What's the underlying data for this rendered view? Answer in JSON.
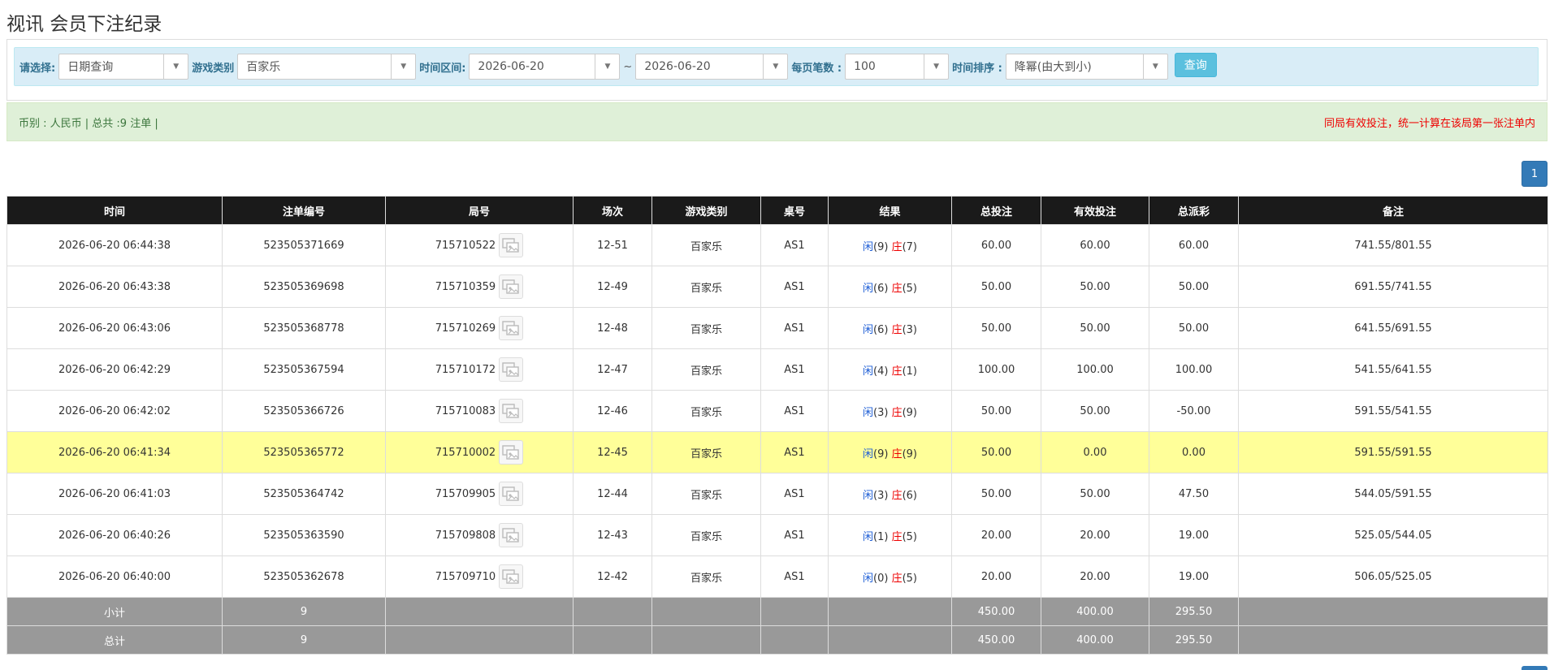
{
  "page": {
    "title": "视讯 会员下注纪录"
  },
  "filters": {
    "select_label": "请选择:",
    "select_value": "日期查询",
    "game_label": "游戏类别",
    "game_value": "百家乐",
    "time_label": "时间区间:",
    "date_from": "2026-06-20",
    "tilde": "~",
    "date_to": "2026-06-20",
    "per_page_label": "每页笔数 :",
    "per_page_value": "100",
    "sort_label": "时间排序 :",
    "sort_value": "降幂(由大到小)",
    "query_button": "查询"
  },
  "summary": {
    "left": "币别 : 人民币 | 总共 :9 注单 |",
    "right": "同局有效投注，统一计算在该局第一张注单内"
  },
  "pagination": {
    "current": "1"
  },
  "table": {
    "headers": [
      "时间",
      "注单编号",
      "局号",
      "场次",
      "游戏类别",
      "桌号",
      "结果",
      "总投注",
      "有效投注",
      "总派彩",
      "备注"
    ],
    "rows": [
      {
        "time": "2026-06-20 06:44:38",
        "bet_id": "523505371669",
        "round": "715710522",
        "session": "12-51",
        "game": "百家乐",
        "table": "AS1",
        "player_label": "闲",
        "player_pts": "(9)",
        "banker_label": "庄",
        "banker_pts": "(7)",
        "total_bet": "60.00",
        "valid_bet": "60.00",
        "payout": "60.00",
        "payout_negative": false,
        "note": "741.55/801.55",
        "highlight": false
      },
      {
        "time": "2026-06-20 06:43:38",
        "bet_id": "523505369698",
        "round": "715710359",
        "session": "12-49",
        "game": "百家乐",
        "table": "AS1",
        "player_label": "闲",
        "player_pts": "(6)",
        "banker_label": "庄",
        "banker_pts": "(5)",
        "total_bet": "50.00",
        "valid_bet": "50.00",
        "payout": "50.00",
        "payout_negative": false,
        "note": "691.55/741.55",
        "highlight": false
      },
      {
        "time": "2026-06-20 06:43:06",
        "bet_id": "523505368778",
        "round": "715710269",
        "session": "12-48",
        "game": "百家乐",
        "table": "AS1",
        "player_label": "闲",
        "player_pts": "(6)",
        "banker_label": "庄",
        "banker_pts": "(3)",
        "total_bet": "50.00",
        "valid_bet": "50.00",
        "payout": "50.00",
        "payout_negative": false,
        "note": "641.55/691.55",
        "highlight": false
      },
      {
        "time": "2026-06-20 06:42:29",
        "bet_id": "523505367594",
        "round": "715710172",
        "session": "12-47",
        "game": "百家乐",
        "table": "AS1",
        "player_label": "闲",
        "player_pts": "(4)",
        "banker_label": "庄",
        "banker_pts": "(1)",
        "total_bet": "100.00",
        "valid_bet": "100.00",
        "payout": "100.00",
        "payout_negative": false,
        "note": "541.55/641.55",
        "highlight": false
      },
      {
        "time": "2026-06-20 06:42:02",
        "bet_id": "523505366726",
        "round": "715710083",
        "session": "12-46",
        "game": "百家乐",
        "table": "AS1",
        "player_label": "闲",
        "player_pts": "(3)",
        "banker_label": "庄",
        "banker_pts": "(9)",
        "total_bet": "50.00",
        "valid_bet": "50.00",
        "payout": "-50.00",
        "payout_negative": true,
        "note": "591.55/541.55",
        "highlight": false
      },
      {
        "time": "2026-06-20 06:41:34",
        "bet_id": "523505365772",
        "round": "715710002",
        "session": "12-45",
        "game": "百家乐",
        "table": "AS1",
        "player_label": "闲",
        "player_pts": "(9)",
        "banker_label": "庄",
        "banker_pts": "(9)",
        "total_bet": "50.00",
        "valid_bet": "0.00",
        "payout": "0.00",
        "payout_negative": false,
        "note": "591.55/591.55",
        "highlight": true
      },
      {
        "time": "2026-06-20 06:41:03",
        "bet_id": "523505364742",
        "round": "715709905",
        "session": "12-44",
        "game": "百家乐",
        "table": "AS1",
        "player_label": "闲",
        "player_pts": "(3)",
        "banker_label": "庄",
        "banker_pts": "(6)",
        "total_bet": "50.00",
        "valid_bet": "50.00",
        "payout": "47.50",
        "payout_negative": false,
        "note": "544.05/591.55",
        "highlight": false
      },
      {
        "time": "2026-06-20 06:40:26",
        "bet_id": "523505363590",
        "round": "715709808",
        "session": "12-43",
        "game": "百家乐",
        "table": "AS1",
        "player_label": "闲",
        "player_pts": "(1)",
        "banker_label": "庄",
        "banker_pts": "(5)",
        "total_bet": "20.00",
        "valid_bet": "20.00",
        "payout": "19.00",
        "payout_negative": false,
        "note": "525.05/544.05",
        "highlight": false
      },
      {
        "time": "2026-06-20 06:40:00",
        "bet_id": "523505362678",
        "round": "715709710",
        "session": "12-42",
        "game": "百家乐",
        "table": "AS1",
        "player_label": "闲",
        "player_pts": "(0)",
        "banker_label": "庄",
        "banker_pts": "(5)",
        "total_bet": "20.00",
        "valid_bet": "20.00",
        "payout": "19.00",
        "payout_negative": false,
        "note": "506.05/525.05",
        "highlight": false
      }
    ],
    "subtotal": {
      "label": "小计",
      "count": "9",
      "total_bet": "450.00",
      "valid_bet": "400.00",
      "payout": "295.50"
    },
    "total": {
      "label": "总计",
      "count": "9",
      "total_bet": "450.00",
      "valid_bet": "400.00",
      "payout": "295.50"
    }
  }
}
